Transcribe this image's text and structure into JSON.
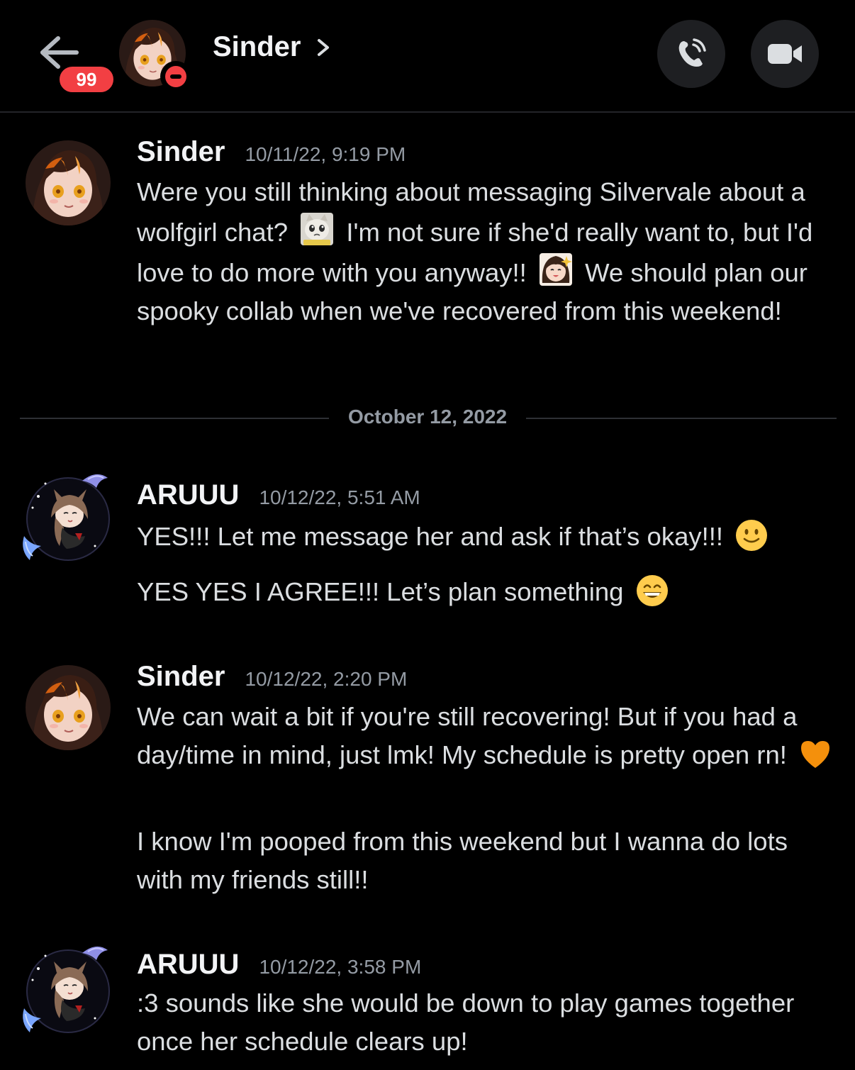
{
  "header": {
    "back_label": "Back",
    "unread_badge": "99",
    "title": "Sinder",
    "chevron": ">",
    "call_icon": "phone-icon",
    "video_icon": "video-camera-icon"
  },
  "divider": {
    "date": "October 12, 2022"
  },
  "messages": [
    {
      "author": "Sinder",
      "timestamp": "10/11/22, 9:19 PM",
      "parts": [
        "Were you still thinking about messaging Silvervale about a wolfgirl chat?",
        "I'm not sure if she'd really want to, but I'd love to do more with you anyway!!",
        "We should plan our spooky collab when we've recovered from this weekend!"
      ]
    },
    {
      "author": "ARUUU",
      "timestamp": "10/12/22, 5:51 AM",
      "lines": [
        "YES!!! Let me message her and ask if that’s okay!!!",
        "YES YES I AGREE!!! Let’s plan something"
      ]
    },
    {
      "author": "Sinder",
      "timestamp": "10/12/22, 2:20 PM",
      "lines": [
        "We can wait a bit if you're still recovering! But if you had a day/time in mind, just lmk! My schedule is pretty open rn!",
        "I know I'm pooped from this weekend but I wanna do lots with my friends still!!"
      ]
    },
    {
      "author": "ARUUU",
      "timestamp": "10/12/22, 3:58 PM",
      "lines": [
        ":3 sounds like she would be down to play games together once her schedule clears up!"
      ]
    }
  ],
  "colors": {
    "background": "#000000",
    "text": "#dbdee1",
    "author": "#f2f3f5",
    "timestamp": "#949ba4",
    "badge": "#f23f43",
    "button_bg": "#1e1f22"
  }
}
